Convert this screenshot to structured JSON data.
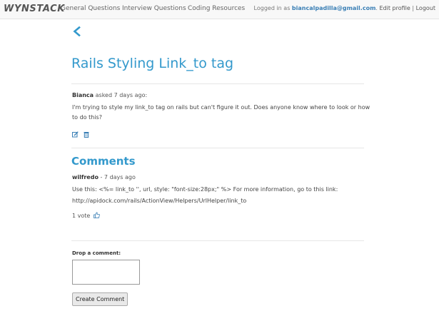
{
  "navbar": {
    "brand": "WYNSTACK",
    "links": [
      "General Questions",
      "Interview Questions",
      "Coding Resources"
    ],
    "logged_in_prefix": "Logged in as",
    "email": "biancalpadilla@gmail.com",
    "dot": ".",
    "edit_profile": "Edit profile",
    "separator": "|",
    "logout": "Logout"
  },
  "question": {
    "title": "Rails Styling Link_to tag",
    "author": "Bianca",
    "asked": "asked 7 days ago:",
    "body": "I'm trying to style my link_to tag on rails but can't figure it out. Does anyone know where to look or how to do this?"
  },
  "comments": {
    "heading": "Comments",
    "items": [
      {
        "author": "wilfredo",
        "time": "- 7 days ago",
        "line1": "Use this: <%= link_to '', url, style: \"font-size:28px;\" %> For more information, go to this link:",
        "line2": "http://apidock.com/rails/ActionView/Helpers/UrlHelper/link_to",
        "votes": "1 vote"
      }
    ]
  },
  "form": {
    "label": "Drop a comment:",
    "textarea_value": "",
    "submit": "Create Comment"
  },
  "colors": {
    "accent": "#3399cc",
    "link": "#3a7fb5"
  },
  "icons": [
    "back-chevron-icon",
    "edit-icon",
    "trash-icon",
    "thumbs-up-icon"
  ]
}
